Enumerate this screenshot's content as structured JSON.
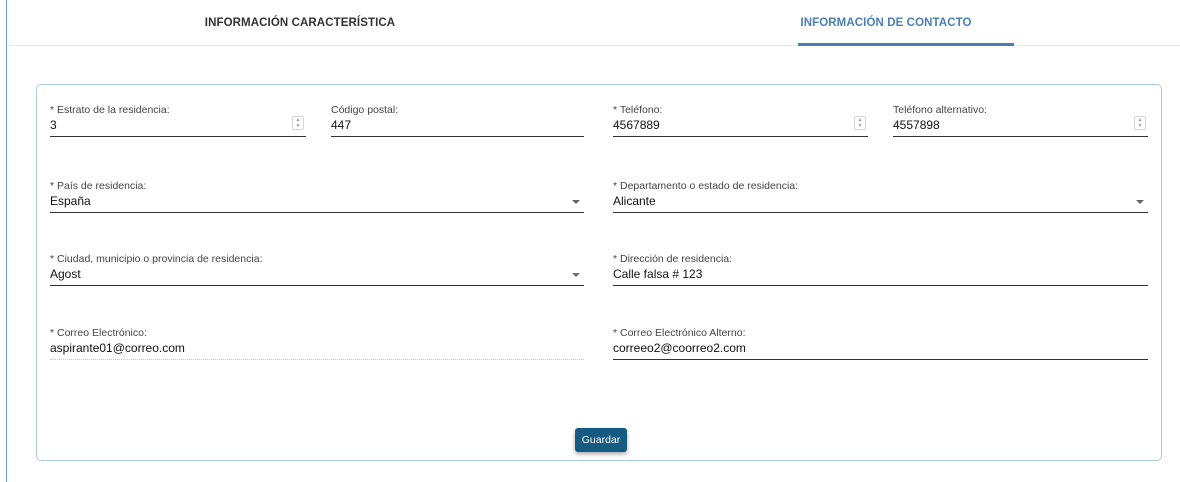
{
  "tabs": [
    {
      "label": "INFORMACIÓN CARACTERÍSTICA",
      "active": false
    },
    {
      "label": "INFORMACIÓN DE CONTACTO",
      "active": true
    }
  ],
  "colors": {
    "accent": "#4a7fb5",
    "button": "#155a80",
    "card_border": "#a9cbe6"
  },
  "form": {
    "estrato": {
      "label": "* Estrato de la residencia:",
      "value": "3"
    },
    "codigo_postal": {
      "label": "Código postal:",
      "value": "447"
    },
    "telefono": {
      "label": "* Teléfono:",
      "value": "4567889"
    },
    "telefono_alt": {
      "label": "Teléfono alternativo:",
      "value": "4557898"
    },
    "pais": {
      "label": "* País de residencia:",
      "value": "España"
    },
    "departamento": {
      "label": "* Departamento o estado de residencia:",
      "value": "Alicante"
    },
    "ciudad": {
      "label": "* Ciudad, municipio o provincia de residencia:",
      "value": "Agost"
    },
    "direccion": {
      "label": "* Dirección de residencia:",
      "value": "Calle falsa # 123"
    },
    "correo": {
      "label": "* Correo Electrónico:",
      "value": "aspirante01@correo.com"
    },
    "correo_alt": {
      "label": "* Correo Electrónico Alterno:",
      "value": "correeo2@coorreo2.com"
    }
  },
  "actions": {
    "save_label": "Guardar"
  },
  "icons": {
    "spinner": "spinner-icon",
    "dropdown": "dropdown-arrow-icon"
  }
}
